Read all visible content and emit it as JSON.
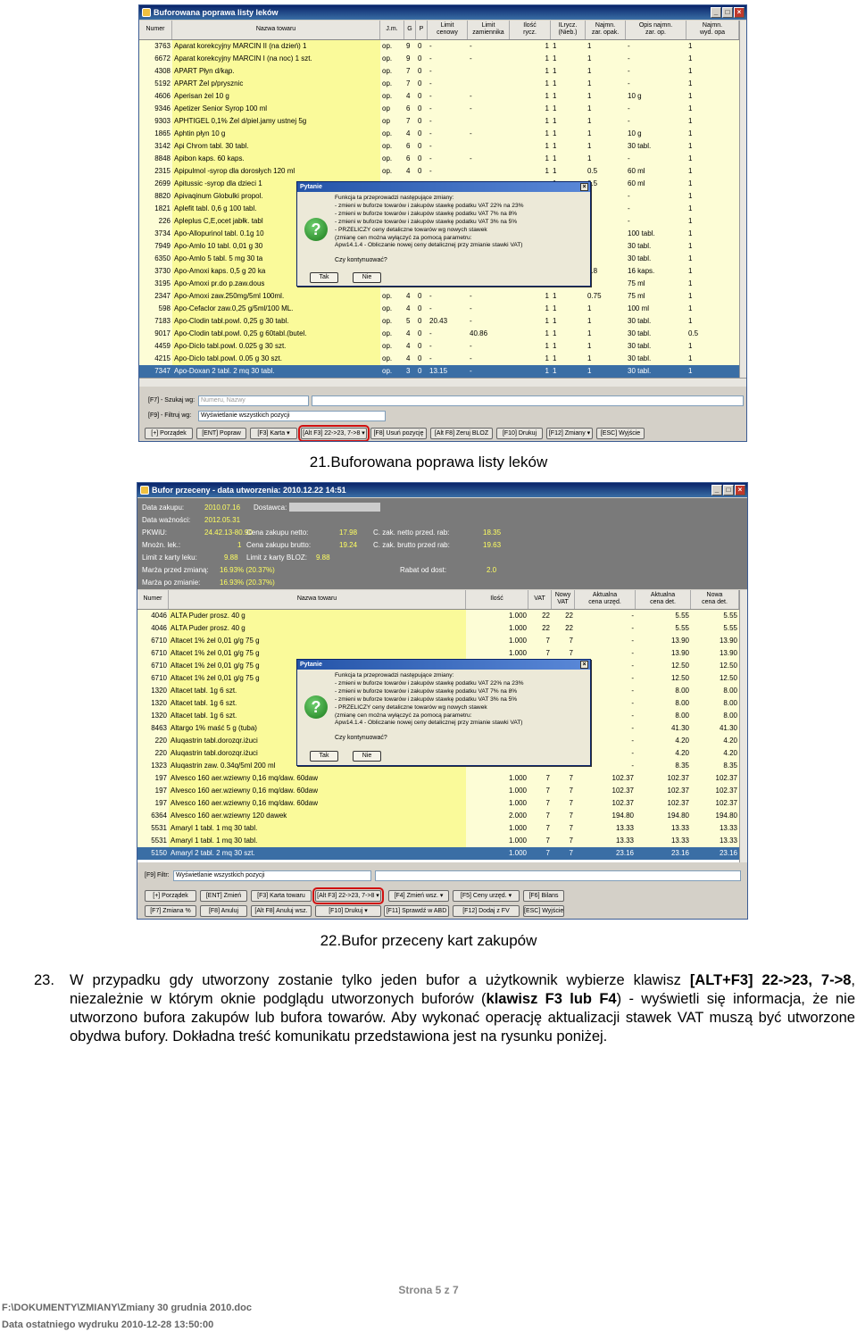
{
  "win1": {
    "title": "Buforowana poprawa listy leków",
    "columns": [
      [
        "Numer"
      ],
      [
        "Nazwa towaru"
      ],
      [
        "J.m."
      ],
      [
        "G"
      ],
      [
        "P"
      ],
      [
        "Limit",
        "cenowy"
      ],
      [
        "Limit",
        "zamiennika"
      ],
      [
        "Ilość",
        "rycz."
      ],
      [
        "ILrycz.",
        "(Nieb.)"
      ],
      [
        "Najmn.",
        "zar. opak."
      ],
      [
        "Opis najmn.",
        "zar. op."
      ],
      [
        "Najmn.",
        "wyd. opa"
      ]
    ],
    "rows": [
      [
        "3763",
        "Aparat korekcyjny MARCIN II (na dzień) 1",
        "op.",
        "9",
        "0",
        "-",
        "-",
        "1",
        "1",
        "1",
        "-",
        "1"
      ],
      [
        "6672",
        "Aparat korekcyjny MARCIN I (na noc) 1 szt.",
        "op.",
        "9",
        "0",
        "-",
        "-",
        "1",
        "1",
        "1",
        "-",
        "1"
      ],
      [
        "4308",
        "APART Płyn d/kąp.",
        "op.",
        "7",
        "0",
        "-",
        "",
        "1",
        "1",
        "1",
        "-",
        "1"
      ],
      [
        "5192",
        "APART Żel p/prysznic",
        "op.",
        "7",
        "0",
        "-",
        "",
        "1",
        "1",
        "1",
        "-",
        "1"
      ],
      [
        "4606",
        "Aperisan żel 10 g",
        "op.",
        "4",
        "0",
        "-",
        "-",
        "1",
        "1",
        "1",
        "10 g",
        "1"
      ],
      [
        "9346",
        "Apetizer Senior Syrop 100 ml",
        "op",
        "6",
        "0",
        "-",
        "-",
        "1",
        "1",
        "1",
        "-",
        "1"
      ],
      [
        "9303",
        "APHTIGEL 0,1% Żel d/piel.jamy ustnej 5g",
        "op",
        "7",
        "0",
        "-",
        "",
        "1",
        "1",
        "1",
        "-",
        "1"
      ],
      [
        "1865",
        "Aphtin płyn 10 g",
        "op.",
        "4",
        "0",
        "-",
        "-",
        "1",
        "1",
        "1",
        "10 g",
        "1"
      ],
      [
        "3142",
        "Api Chrom tabl. 30 tabl.",
        "op.",
        "6",
        "0",
        "-",
        "",
        "1",
        "1",
        "1",
        "30 tabl.",
        "1"
      ],
      [
        "8848",
        "Apibon kaps. 60 kaps.",
        "op.",
        "6",
        "0",
        "-",
        "-",
        "1",
        "1",
        "1",
        "-",
        "1"
      ],
      [
        "2315",
        "Apipulmol -syrop dla dorosłych 120 ml",
        "op.",
        "4",
        "0",
        "-",
        "",
        "1",
        "1",
        "0.5",
        "60 ml",
        "1"
      ],
      [
        "2699",
        "Apitussic -syrop dla dzieci 1",
        "",
        "",
        "",
        "",
        "",
        "",
        "1",
        "0.5",
        "60 ml",
        "1"
      ],
      [
        "8820",
        "Apivaqinum Globulki propol.",
        "",
        "",
        "",
        "",
        "",
        "",
        "1",
        "1",
        "-",
        "1"
      ],
      [
        "1821",
        "Aplefit tabl. 0,6 g 100 tabl.",
        "",
        "",
        "",
        "",
        "",
        "",
        "1",
        "1",
        "-",
        "1"
      ],
      [
        "226",
        "Apleplus C,E,ocet jabłk. tabl",
        "",
        "",
        "",
        "",
        "",
        "",
        "1",
        "1",
        "-",
        "1"
      ],
      [
        "3734",
        "Apo-Allopurinol tabl. 0.1g 10",
        "",
        "",
        "",
        "",
        "",
        "",
        "1",
        "1",
        "100 tabl.",
        "1"
      ],
      [
        "7949",
        "Apo-Amlo 10 tabl. 0,01 g 30",
        "",
        "",
        "",
        "",
        "",
        "",
        "1",
        "1",
        "30 tabl.",
        "1"
      ],
      [
        "6350",
        "Apo-Amlo 5 tabl. 5 mg 30 ta",
        "",
        "",
        "",
        "",
        "",
        "",
        "1",
        "1",
        "30 tabl.",
        "1"
      ],
      [
        "3730",
        "Apo-Amoxi kaps. 0,5 g 20 ka",
        "",
        "",
        "",
        "",
        "",
        "",
        "1",
        "0.8",
        "16 kaps.",
        "1"
      ],
      [
        "3195",
        "Apo-Amoxi pr.do p.zaw.dous",
        "",
        "",
        "",
        "",
        "",
        "",
        "1",
        "1",
        "75 ml",
        "1"
      ],
      [
        "2347",
        "Apo-Amoxi zaw.250mg/5ml 100ml.",
        "op.",
        "4",
        "0",
        "-",
        "-",
        "1",
        "1",
        "0.75",
        "75 ml",
        "1"
      ],
      [
        "598",
        "Apo-Cefaclor zaw.0,25 g/5ml/100 ML.",
        "op.",
        "4",
        "0",
        "-",
        "-",
        "1",
        "1",
        "1",
        "100 ml",
        "1"
      ],
      [
        "7183",
        "Apo-Clodin tabl.powl. 0,25 g 30 tabl.",
        "op.",
        "5",
        "0",
        "20.43",
        "-",
        "1",
        "1",
        "1",
        "30 tabl.",
        "1"
      ],
      [
        "9017",
        "Apo-Clodin tabl.powl. 0,25 g 60tabl.(butel.",
        "op.",
        "4",
        "0",
        "-",
        "40.86",
        "1",
        "1",
        "1",
        "30 tabl.",
        "0.5"
      ],
      [
        "4459",
        "Apo-Diclo tabl.powl. 0.025 g 30 szt.",
        "op.",
        "4",
        "0",
        "-",
        "-",
        "1",
        "1",
        "1",
        "30 tabl.",
        "1"
      ],
      [
        "4215",
        "Apo-Diclo tabl.powl. 0.05 g 30 szt.",
        "op.",
        "4",
        "0",
        "-",
        "-",
        "1",
        "1",
        "1",
        "30 tabl.",
        "1"
      ],
      [
        "7347",
        "Apo-Doxan 2 tabl. 2 mq 30 tabl.",
        "op.",
        "3",
        "0",
        "13.15",
        "-",
        "1",
        "1",
        "1",
        "30 tabl.",
        "1"
      ]
    ],
    "search_label": "[F7] - Szukaj wg:",
    "search_value": "Numeru, Nazwy",
    "filter_label": "[F9] - Filtruj wg:",
    "filter_value": "Wyświetlanie wszystkich pozycji",
    "buttons": [
      "[+] Porządek",
      "[ENT] Popraw",
      "[F3] Karta",
      "[Alt F3] 22->23, 7->8",
      "[F8] Usuń pozycję",
      "[Alt F8] Zeruj BLOZ",
      "[F10] Drukuj",
      "[F12] Zmiany",
      "[ESC] Wyjście"
    ]
  },
  "dialog": {
    "title": "Pytanie",
    "lines": [
      "Funkcja ta przeprowadzi następujące zmiany:",
      "- zmieni w buforze towarów i zakupów stawkę podatku VAT 22% na 23%",
      "- zmieni w buforze towarów i zakupów stawkę podatku VAT 7% na 8%",
      "- zmieni w buforze towarów i zakupów stawkę podatku VAT 3% na 5%",
      "- PRZELICZY ceny detaliczne towarów wg nowych stawek",
      "   (zmianę cen można wyłączyć za pomocą parametru:",
      "   Apw14.1.4 - Obliczanie nowej ceny detalicznej przy zmianie stawki VAT)"
    ],
    "ask": "Czy kontynuować?",
    "yes": "Tak",
    "no": "Nie"
  },
  "caption1": "21.Buforowana poprawa listy leków",
  "win2": {
    "title": "Bufor przeceny - data utworzenia: 2010.12.22 14:51",
    "info": [
      [
        "Data zakupu:",
        "2010.07.16",
        "Dostawca:",
        ""
      ],
      [
        "Data ważności:",
        "2012.05.31",
        "",
        ""
      ]
    ],
    "pkwiu_label": "PKWiU:",
    "pkwiu": "24.42.13-80.90",
    "mnozn_label": "Mnożn. lek.:",
    "mnozn": "1",
    "limit_karty_label": "Limit z karty leku:",
    "limit_karty": "9.88",
    "limit_bloz_label": "Limit z karty BLOZ:",
    "limit_bloz": "9.88",
    "marza_przed_label": "Marża przed zmianą:",
    "marza_przed": "16.93% (20.37%)",
    "marza_po_label": "Marża po zmianie:",
    "marza_po": "16.93% (20.37%)",
    "cena_netto_label": "Cena zakupu netto:",
    "cena_netto": "17.98",
    "cena_brutto_label": "Cena zakupu brutto:",
    "cena_brutto": "19.24",
    "czak_netto_label": "C. zak. netto przed. rab:",
    "czak_netto": "18.35",
    "czak_brutto_label": "C. zak. brutto przed rab:",
    "czak_brutto": "19.63",
    "rabat_label": "Rabat od dost:",
    "rabat": "2.0",
    "columns": [
      [
        "Numer"
      ],
      [
        "Nazwa towaru"
      ],
      [
        "Ilość"
      ],
      [
        "VAT"
      ],
      [
        "Nowy",
        "VAT"
      ],
      [
        "Aktualna",
        "cena urzęd."
      ],
      [
        "Aktualna",
        "cena det."
      ],
      [
        "Nowa",
        "cena det."
      ]
    ],
    "rows": [
      [
        "4046",
        "ALTA Puder prosz. 40 g",
        "1.000",
        "22",
        "22",
        "-",
        "5.55",
        "5.55"
      ],
      [
        "4046",
        "ALTA Puder prosz. 40 g",
        "1.000",
        "22",
        "22",
        "-",
        "5.55",
        "5.55"
      ],
      [
        "6710",
        "Altacet 1% żel 0,01 g/g 75 g",
        "1.000",
        "7",
        "7",
        "-",
        "13.90",
        "13.90"
      ],
      [
        "6710",
        "Altacet 1% żel 0,01 g/g 75 g",
        "1.000",
        "7",
        "7",
        "-",
        "13.90",
        "13.90"
      ],
      [
        "6710",
        "Altacet 1% żel 0,01 g/g 75 g",
        "",
        "",
        "",
        "-",
        "12.50",
        "12.50"
      ],
      [
        "6710",
        "Altacet 1% żel 0,01 g/g 75 g",
        "",
        "",
        "",
        "-",
        "12.50",
        "12.50"
      ],
      [
        "1320",
        "Altacet tabl. 1g 6 szt.",
        "",
        "",
        "",
        "-",
        "8.00",
        "8.00"
      ],
      [
        "1320",
        "Altacet tabl. 1g 6 szt.",
        "",
        "",
        "",
        "-",
        "8.00",
        "8.00"
      ],
      [
        "1320",
        "Altacet tabl. 1g 6 szt.",
        "",
        "",
        "",
        "-",
        "8.00",
        "8.00"
      ],
      [
        "8463",
        "Altargo 1% maść 5 g (tuba)",
        "",
        "",
        "",
        "-",
        "41.30",
        "41.30"
      ],
      [
        "220",
        "Aluqastrin tabl.dorozqr.iżuci",
        "",
        "",
        "",
        "-",
        "4.20",
        "4.20"
      ],
      [
        "220",
        "Aluqastrin tabl.dorozqr.iżuci",
        "",
        "",
        "",
        "-",
        "4.20",
        "4.20"
      ],
      [
        "1323",
        "Aluqastrin zaw. 0.34q/5ml 200 ml",
        "",
        "",
        "",
        "-",
        "8.35",
        "8.35"
      ],
      [
        "197",
        "Alvesco 160 aer.wziewny 0,16 mq/daw. 60daw",
        "1.000",
        "7",
        "7",
        "102.37",
        "102.37",
        "102.37"
      ],
      [
        "197",
        "Alvesco 160 aer.wziewny 0,16 mq/daw. 60daw",
        "1.000",
        "7",
        "7",
        "102.37",
        "102.37",
        "102.37"
      ],
      [
        "197",
        "Alvesco 160 aer.wziewny 0,16 mq/daw. 60daw",
        "1.000",
        "7",
        "7",
        "102.37",
        "102.37",
        "102.37"
      ],
      [
        "6364",
        "Alvesco 160 aer.wziewny 120 dawek",
        "2.000",
        "7",
        "7",
        "194.80",
        "194.80",
        "194.80"
      ],
      [
        "5531",
        "Amaryl 1 tabl. 1 mq 30 tabl.",
        "1.000",
        "7",
        "7",
        "13.33",
        "13.33",
        "13.33"
      ],
      [
        "5531",
        "Amaryl 1 tabl. 1 mq 30 tabl.",
        "1.000",
        "7",
        "7",
        "13.33",
        "13.33",
        "13.33"
      ],
      [
        "5150",
        "Amaryl 2 tabl. 2 mq 30 szt.",
        "1.000",
        "7",
        "7",
        "23.16",
        "23.16",
        "23.16"
      ]
    ],
    "filter_label": "[F9] Filtr:",
    "filter_value": "Wyświetlanie wszystkich pozycji",
    "buttons_row1": [
      "[+] Porządek",
      "[ENT] Zmień",
      "[F3] Karta towaru",
      "[Alt F3] 22->23, 7->8",
      "[F4] Zmień wsz.",
      "[F5] Ceny urzęd.",
      "[F6] Bilans"
    ],
    "buttons_row2": [
      "[F7] Zmiana %",
      "[F8] Anuluj",
      "[Alt F8] Anuluj wsz.",
      "[F10] Drukuj",
      "[F11] Sprawdź w ABD",
      "[F12] Dodaj z FV",
      "[ESC] Wyjście"
    ]
  },
  "caption2": "22.Bufor przeceny kart zakupów",
  "para": {
    "num": "23.",
    "t1": "W przypadku gdy utworzony zostanie tylko jeden bufor a użytkownik wybierze klawisz ",
    "b1": "[ALT+F3] 22->23, 7->8",
    "t2": ", niezależnie w którym oknie podglądu utworzonych buforów (",
    "b2": "klawisz F3 lub F4",
    "t3": ") - wyświetli się informacja, że nie utworzono bufora zakupów lub bufora towarów. Aby wykonać operację aktualizacji stawek VAT muszą być utworzone obydwa bufory. Dokładna treść komunikatu przedstawiona jest na rysunku poniżej."
  },
  "footer": {
    "page": "Strona 5 z 7",
    "path": "F:\\DOKUMENTY\\ZMIANY\\Zmiany 30 grudnia 2010.doc",
    "printed": "Data ostatniego wydruku 2010-12-28 13:50:00"
  }
}
